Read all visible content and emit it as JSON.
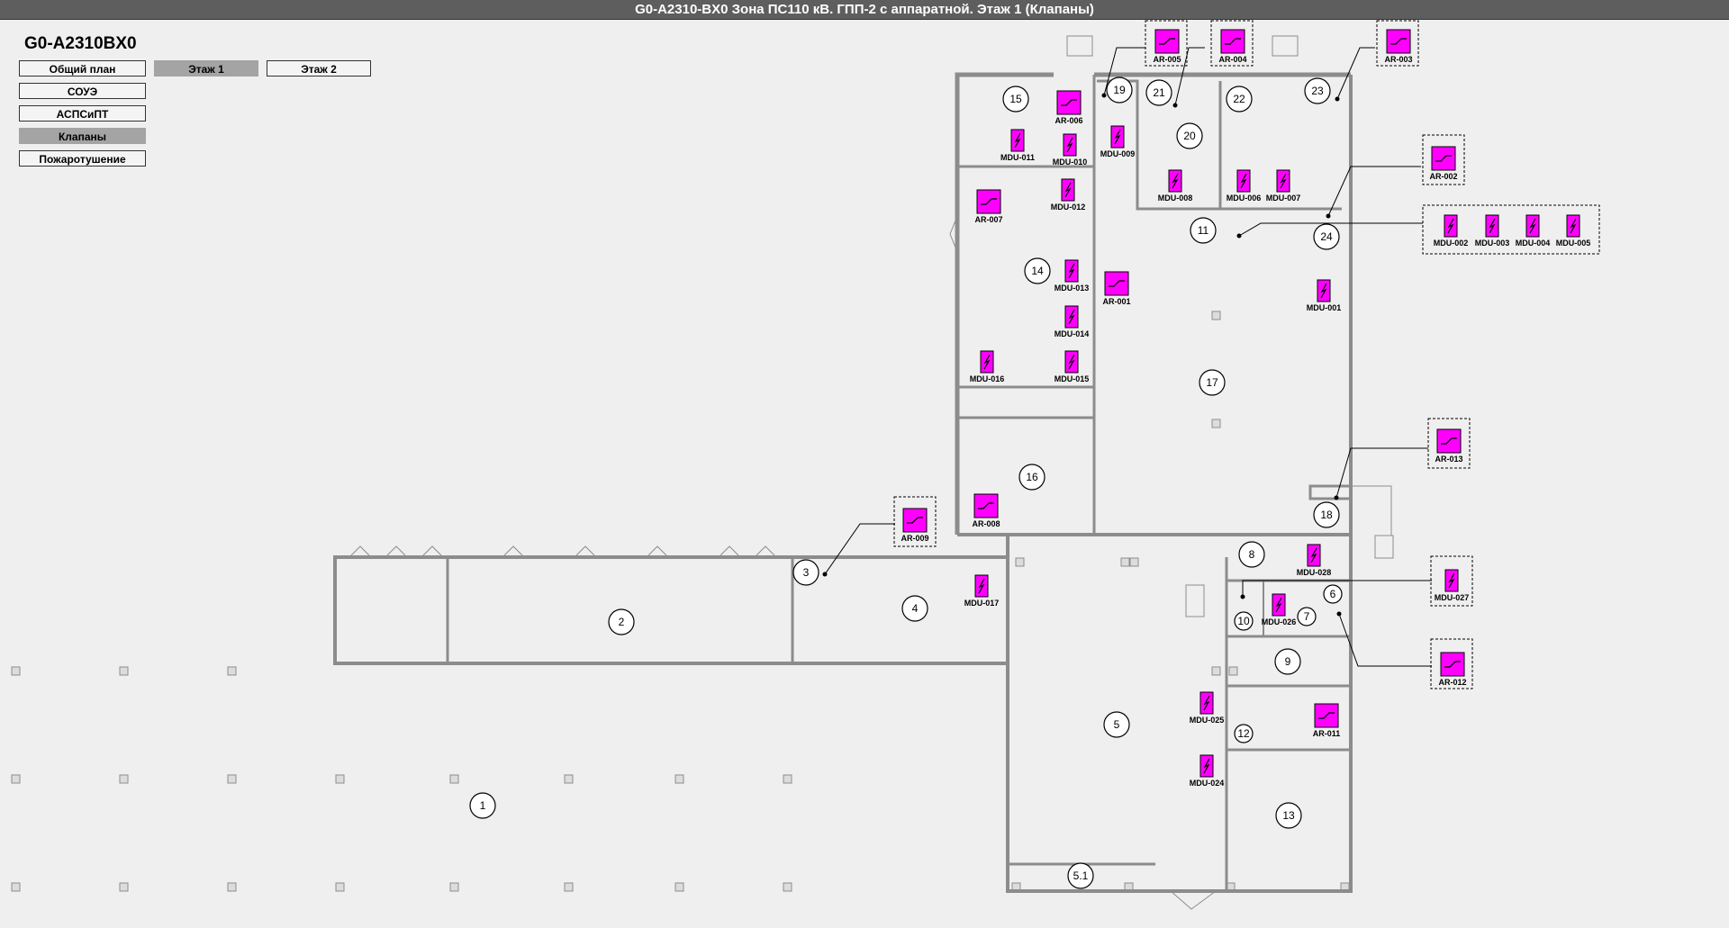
{
  "window": {
    "title": "G0-A2310-BX0 Зона ПС110 кВ. ГПП-2 с аппаратной. Этаж 1 (Клапаны)"
  },
  "object_code": "G0-A2310BX0",
  "nav": {
    "general_plan": "Общий план",
    "floor1": "Этаж 1",
    "floor2": "Этаж 2",
    "soue": "СОУЭ",
    "aps": "АСПСиПТ",
    "valves": "Клапаны",
    "fire": "Пожаротушение"
  },
  "colors": {
    "device_fill": "#ff00ff",
    "wall": "#8c8c8c",
    "background": "#efefef",
    "titlebar": "#5e5e5e",
    "active_button": "#a4a4a4"
  },
  "rooms": [
    "1",
    "2",
    "3",
    "4",
    "5",
    "5.1",
    "6",
    "7",
    "8",
    "9",
    "10",
    "11",
    "12",
    "13",
    "14",
    "15",
    "16",
    "17",
    "18",
    "19",
    "20",
    "21",
    "22",
    "23",
    "24"
  ],
  "dampers_ar": [
    "AR-001",
    "AR-002",
    "AR-003",
    "AR-004",
    "AR-005",
    "AR-006",
    "AR-007",
    "AR-008",
    "AR-009",
    "AR-011",
    "AR-012",
    "AR-013"
  ],
  "dampers_mdu": [
    "MDU-001",
    "MDU-002",
    "MDU-003",
    "MDU-004",
    "MDU-005",
    "MDU-006",
    "MDU-007",
    "MDU-008",
    "MDU-009",
    "MDU-010",
    "MDU-011",
    "MDU-012",
    "MDU-013",
    "MDU-014",
    "MDU-015",
    "MDU-016",
    "MDU-017",
    "MDU-024",
    "MDU-025",
    "MDU-026",
    "MDU-027",
    "MDU-028"
  ]
}
